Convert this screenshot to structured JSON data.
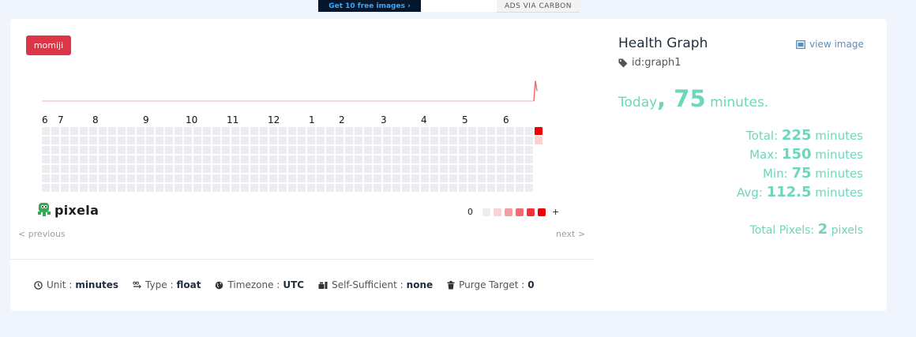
{
  "ad": {
    "image_text": "Get 10 free images ›",
    "via_text": "ADS VIA CARBON"
  },
  "user": "momiji",
  "graph": {
    "title": "Health Graph",
    "id_label": "id:graph1",
    "view_image": "view image",
    "today_prefix": "Today",
    "today_comma": ", ",
    "today_value": "75",
    "today_unit": "minutes.",
    "stats": [
      {
        "label": "Total:",
        "value": "225",
        "unit": "minutes"
      },
      {
        "label": "Max:",
        "value": "150",
        "unit": "minutes"
      },
      {
        "label": "Min:",
        "value": "75",
        "unit": "minutes"
      },
      {
        "label": "Avg:",
        "value": "112.5",
        "unit": "minutes"
      }
    ],
    "total_pixels_label": "Total Pixels:",
    "total_pixels_value": "2",
    "total_pixels_unit": "pixels"
  },
  "calendar": {
    "month_labels": [
      "6",
      "7",
      "8",
      "9",
      "10",
      "11",
      "12",
      "1",
      "2",
      "3",
      "4",
      "5",
      "6"
    ],
    "weeks": 53,
    "colors": {
      "empty": "#ebedf0",
      "today": "#f00000",
      "low": "#fbd1d2"
    }
  },
  "chart_data": {
    "type": "line",
    "series": [
      {
        "values": [
          0,
          150,
          75
        ]
      }
    ]
  },
  "legend": {
    "min_label": "0",
    "max_label": "+",
    "colors": [
      "#ebedf0",
      "#fbd1d2",
      "#f59ea2",
      "#f46a6f",
      "#f53038",
      "#f00000"
    ]
  },
  "nav": {
    "previous": "< previous",
    "next": "next >"
  },
  "meta": [
    {
      "label": "Unit",
      "sep": ":",
      "value": "minutes",
      "icon": "clock-icon"
    },
    {
      "label": "Type",
      "sep": ":",
      "value": "float",
      "icon": "decimal-icon"
    },
    {
      "label": "Timezone",
      "sep": ":",
      "value": "UTC",
      "icon": "globe-icon"
    },
    {
      "label": "Self-Sufficient",
      "sep": ":",
      "value": "none",
      "icon": "tool-icon"
    },
    {
      "label": "Purge Target",
      "sep": ":",
      "value": "0",
      "icon": "trash-icon"
    }
  ],
  "brand": "pixela"
}
